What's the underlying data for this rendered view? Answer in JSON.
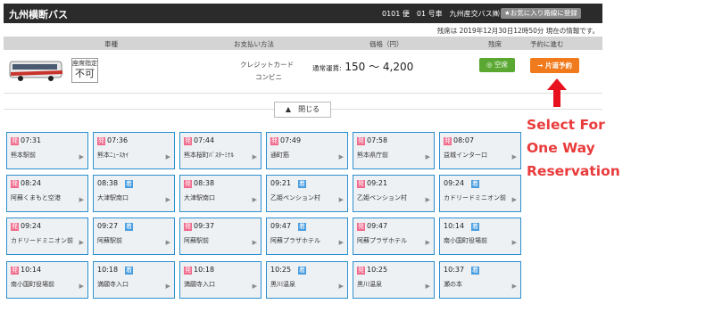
{
  "header": {
    "title": "九州横断バス",
    "bus_info": "0101 便　01 号車　九州産交バス㈱",
    "fav_button": "★お気に入り路線に登録"
  },
  "remaining_note": "残席は 2019年12月30日12時50分 現在の情報です。",
  "columns": {
    "type": "車種",
    "payment": "お支払い方法",
    "price": "価格（円）",
    "vacancy": "残席",
    "reserve": "予約に進む"
  },
  "fare": {
    "seat_label": "座席指定",
    "seat_value": "不可",
    "payment_1": "クレジットカード",
    "payment_2": "コンビニ",
    "price_label": "通常運賃:",
    "price_value": "150 〜 4,200",
    "vacancy_button": "◎ 空席",
    "reserve_button": "→ 片道予約"
  },
  "close_button": "▲　閉じる",
  "annotation": [
    "Select For",
    "One Way",
    "Reservation"
  ],
  "colors": {
    "pink_badge": "#f06a8c",
    "blue_badge": "#4a9ee0",
    "reserve": "#f07a1c",
    "vacancy": "#5aa832",
    "annotation": "#ea3b3b"
  },
  "stops": [
    [
      {
        "badge": "発",
        "badge_color": "pink",
        "time": "07:31",
        "stop": "熊本駅前"
      },
      {
        "badge": "発",
        "badge_color": "pink",
        "time": "07:36",
        "stop": "熊本ﾆｭｰｽｶｲ"
      },
      {
        "badge": "発",
        "badge_color": "pink",
        "time": "07:44",
        "stop": "熊本桜町ﾊﾞｽﾀｰﾐﾅﾙ"
      },
      {
        "badge": "発",
        "badge_color": "pink",
        "time": "07:49",
        "stop": "通町筋"
      },
      {
        "badge": "発",
        "badge_color": "pink",
        "time": "07:58",
        "stop": "熊本県庁前"
      },
      {
        "badge": "発",
        "badge_color": "pink",
        "time": "08:07",
        "stop": "益城インター口"
      }
    ],
    [
      {
        "badge": "発",
        "badge_color": "pink",
        "time": "08:24",
        "stop": "阿蘇くまもと空港"
      },
      {
        "badge": "着",
        "badge_color": "blue",
        "time": "08:38",
        "stop": "大津駅南口"
      },
      {
        "badge": "発",
        "badge_color": "pink",
        "time": "08:38",
        "stop": "大津駅南口"
      },
      {
        "badge": "着",
        "badge_color": "blue",
        "time": "09:21",
        "stop": "乙姫ペンション村"
      },
      {
        "badge": "発",
        "badge_color": "pink",
        "time": "09:21",
        "stop": "乙姫ペンション村"
      },
      {
        "badge": "着",
        "badge_color": "blue",
        "time": "09:24",
        "stop": "カドリードミニオン前"
      }
    ],
    [
      {
        "badge": "発",
        "badge_color": "pink",
        "time": "09:24",
        "stop": "カドリードミニオン前"
      },
      {
        "badge": "着",
        "badge_color": "blue",
        "time": "09:27",
        "stop": "阿蘇駅前"
      },
      {
        "badge": "発",
        "badge_color": "pink",
        "time": "09:37",
        "stop": "阿蘇駅前"
      },
      {
        "badge": "着",
        "badge_color": "blue",
        "time": "09:47",
        "stop": "阿蘇プラザホテル"
      },
      {
        "badge": "発",
        "badge_color": "pink",
        "time": "09:47",
        "stop": "阿蘇プラザホテル"
      },
      {
        "badge": "着",
        "badge_color": "blue",
        "time": "10:14",
        "stop": "南小国町役場前"
      }
    ],
    [
      {
        "badge": "発",
        "badge_color": "pink",
        "time": "10:14",
        "stop": "南小国町役場前"
      },
      {
        "badge": "着",
        "badge_color": "blue",
        "time": "10:18",
        "stop": "満願寺入口"
      },
      {
        "badge": "発",
        "badge_color": "pink",
        "time": "10:18",
        "stop": "満願寺入口"
      },
      {
        "badge": "着",
        "badge_color": "blue",
        "time": "10:25",
        "stop": "黒川温泉"
      },
      {
        "badge": "発",
        "badge_color": "pink",
        "time": "10:25",
        "stop": "黒川温泉"
      },
      {
        "badge": "着",
        "badge_color": "blue",
        "time": "10:37",
        "stop": "瀬の本"
      }
    ]
  ]
}
